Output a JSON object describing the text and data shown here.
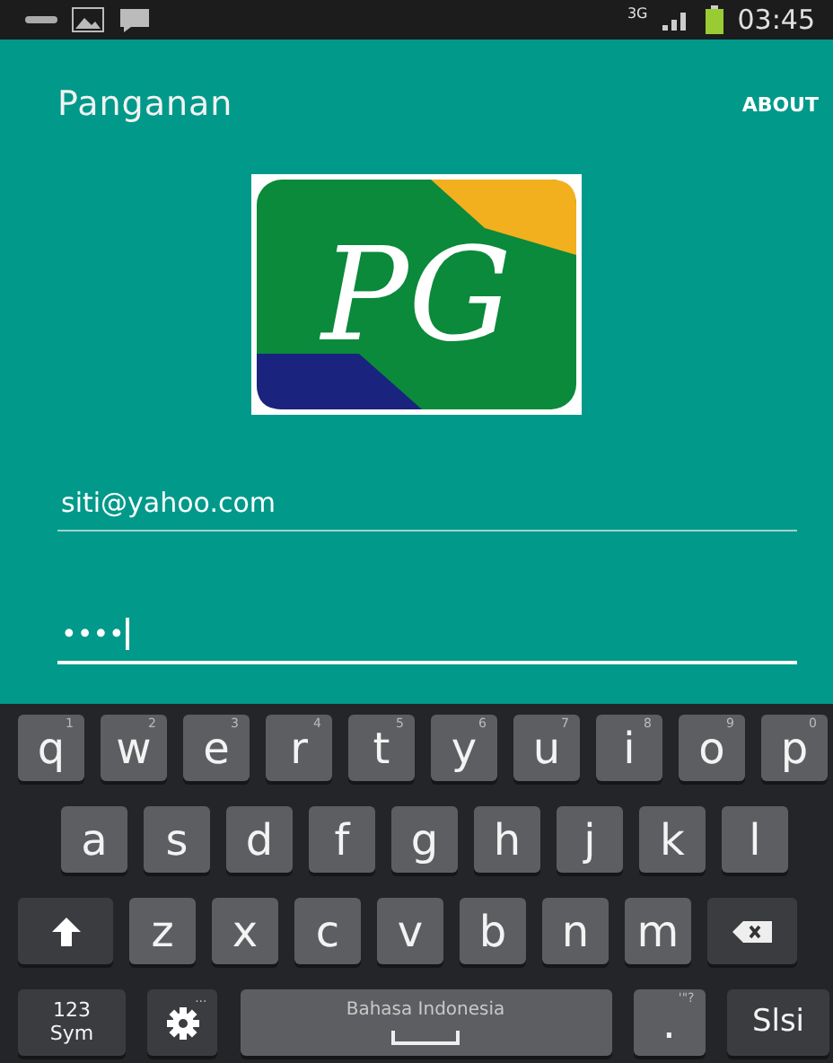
{
  "status_bar": {
    "network": "3G",
    "time": "03:45"
  },
  "app_bar": {
    "title": "Panganan",
    "action": "ABOUT"
  },
  "logo": {
    "text": "PG"
  },
  "fields": [
    {
      "value": "siti@yahoo.com",
      "focused": false
    },
    {
      "value": "••••",
      "focused": true
    }
  ],
  "keyboard": {
    "rows": [
      {
        "keys": [
          {
            "kind": "char",
            "label": "q",
            "hint": "1"
          },
          {
            "kind": "char",
            "label": "w",
            "hint": "2"
          },
          {
            "kind": "char",
            "label": "e",
            "hint": "3"
          },
          {
            "kind": "char",
            "label": "r",
            "hint": "4"
          },
          {
            "kind": "char",
            "label": "t",
            "hint": "5"
          },
          {
            "kind": "char",
            "label": "y",
            "hint": "6"
          },
          {
            "kind": "char",
            "label": "u",
            "hint": "7"
          },
          {
            "kind": "char",
            "label": "i",
            "hint": "8"
          },
          {
            "kind": "char",
            "label": "o",
            "hint": "9"
          },
          {
            "kind": "char",
            "label": "p",
            "hint": "0"
          }
        ]
      },
      {
        "keys": [
          {
            "kind": "char",
            "label": "a"
          },
          {
            "kind": "char",
            "label": "s"
          },
          {
            "kind": "char",
            "label": "d"
          },
          {
            "kind": "char",
            "label": "f"
          },
          {
            "kind": "char",
            "label": "g"
          },
          {
            "kind": "char",
            "label": "h"
          },
          {
            "kind": "char",
            "label": "j"
          },
          {
            "kind": "char",
            "label": "k"
          },
          {
            "kind": "char",
            "label": "l"
          }
        ]
      },
      {
        "keys": [
          {
            "kind": "shift"
          },
          {
            "kind": "char",
            "label": "z"
          },
          {
            "kind": "char",
            "label": "x"
          },
          {
            "kind": "char",
            "label": "c"
          },
          {
            "kind": "char",
            "label": "v"
          },
          {
            "kind": "char",
            "label": "b"
          },
          {
            "kind": "char",
            "label": "n"
          },
          {
            "kind": "char",
            "label": "m"
          },
          {
            "kind": "backspace"
          }
        ]
      },
      {
        "keys": [
          {
            "kind": "sym",
            "label": "123 Sym"
          },
          {
            "kind": "settings",
            "hint": "..."
          },
          {
            "kind": "space",
            "label": "Bahasa Indonesia"
          },
          {
            "kind": "char",
            "label": ".",
            "hint": "'\"?"
          },
          {
            "kind": "enter",
            "label": "Slsi"
          }
        ]
      }
    ]
  }
}
